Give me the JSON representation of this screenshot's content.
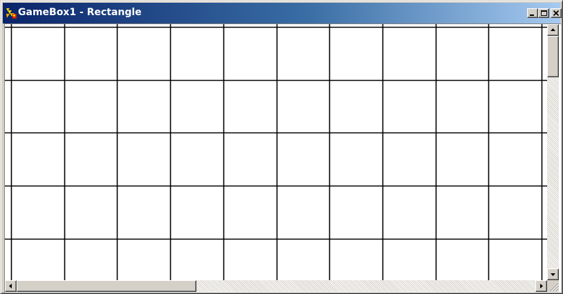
{
  "window": {
    "title": "GameBox1 - Rectangle",
    "app_icon": "gamebox-app-icon",
    "controls": {
      "minimize_icon": "minimize-icon",
      "maximize_icon": "maximize-icon",
      "close_icon": "close-icon"
    }
  },
  "grid": {
    "visible_columns": 10,
    "visible_rows": 5,
    "line_color": "#000000",
    "background_color": "#ffffff"
  },
  "scrollbars": {
    "vertical": {
      "up_icon": "arrow-up-icon",
      "down_icon": "arrow-down-icon"
    },
    "horizontal": {
      "left_icon": "arrow-left-icon",
      "right_icon": "arrow-right-icon"
    }
  },
  "colors": {
    "titlebar_start": "#0a246a",
    "titlebar_end": "#a6caf0",
    "chrome": "#d4d0c8"
  }
}
